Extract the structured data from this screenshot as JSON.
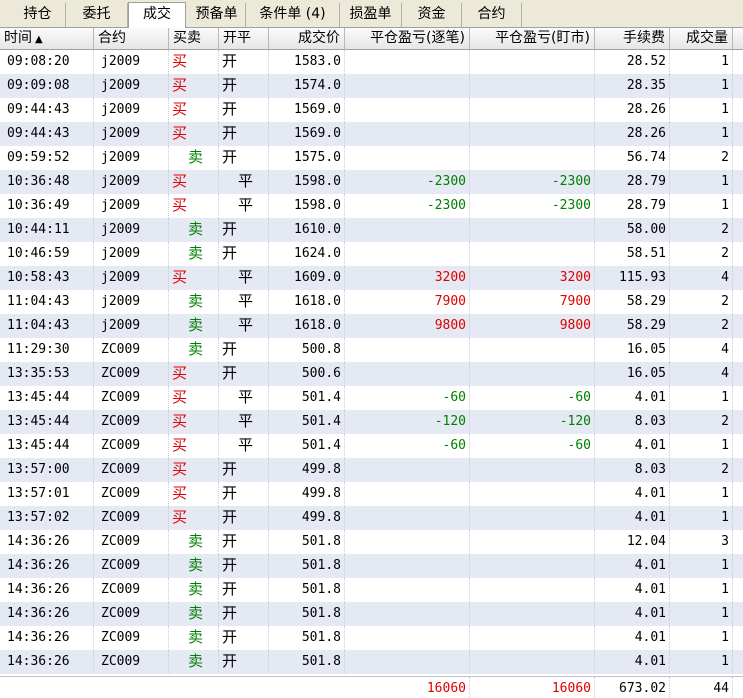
{
  "tabs": [
    {
      "label": "持仓"
    },
    {
      "label": "委托"
    },
    {
      "label": "成交"
    },
    {
      "label": "预备单"
    },
    {
      "label": "条件单 (4)"
    },
    {
      "label": "损盈单"
    },
    {
      "label": "资金"
    },
    {
      "label": "合约"
    }
  ],
  "active_tab": "成交",
  "columns": {
    "time": "时间",
    "contract": "合约",
    "side": "买卖",
    "openclose": "开平",
    "price": "成交价",
    "pnl_close": "平仓盈亏(逐笔)",
    "pnl_mark": "平仓盈亏(盯市)",
    "fee": "手续费",
    "qty": "成交量"
  },
  "sort_icon": "▲",
  "trades": [
    {
      "time": "09:08:20",
      "contract": "j2009",
      "side": "买",
      "oc": "开",
      "price": "1583.0",
      "pnl1": "",
      "pnl2": "",
      "fee": "28.52",
      "qty": "1"
    },
    {
      "time": "09:09:08",
      "contract": "j2009",
      "side": "买",
      "oc": "开",
      "price": "1574.0",
      "pnl1": "",
      "pnl2": "",
      "fee": "28.35",
      "qty": "1"
    },
    {
      "time": "09:44:43",
      "contract": "j2009",
      "side": "买",
      "oc": "开",
      "price": "1569.0",
      "pnl1": "",
      "pnl2": "",
      "fee": "28.26",
      "qty": "1"
    },
    {
      "time": "09:44:43",
      "contract": "j2009",
      "side": "买",
      "oc": "开",
      "price": "1569.0",
      "pnl1": "",
      "pnl2": "",
      "fee": "28.26",
      "qty": "1"
    },
    {
      "time": "09:59:52",
      "contract": "j2009",
      "side": "卖",
      "oc": "开",
      "price": "1575.0",
      "pnl1": "",
      "pnl2": "",
      "fee": "56.74",
      "qty": "2"
    },
    {
      "time": "10:36:48",
      "contract": "j2009",
      "side": "买",
      "oc": "平",
      "price": "1598.0",
      "pnl1": "-2300",
      "pnl2": "-2300",
      "fee": "28.79",
      "qty": "1"
    },
    {
      "time": "10:36:49",
      "contract": "j2009",
      "side": "买",
      "oc": "平",
      "price": "1598.0",
      "pnl1": "-2300",
      "pnl2": "-2300",
      "fee": "28.79",
      "qty": "1"
    },
    {
      "time": "10:44:11",
      "contract": "j2009",
      "side": "卖",
      "oc": "开",
      "price": "1610.0",
      "pnl1": "",
      "pnl2": "",
      "fee": "58.00",
      "qty": "2"
    },
    {
      "time": "10:46:59",
      "contract": "j2009",
      "side": "卖",
      "oc": "开",
      "price": "1624.0",
      "pnl1": "",
      "pnl2": "",
      "fee": "58.51",
      "qty": "2"
    },
    {
      "time": "10:58:43",
      "contract": "j2009",
      "side": "买",
      "oc": "平",
      "price": "1609.0",
      "pnl1": "3200",
      "pnl2": "3200",
      "fee": "115.93",
      "qty": "4"
    },
    {
      "time": "11:04:43",
      "contract": "j2009",
      "side": "卖",
      "oc": "平",
      "price": "1618.0",
      "pnl1": "7900",
      "pnl2": "7900",
      "fee": "58.29",
      "qty": "2"
    },
    {
      "time": "11:04:43",
      "contract": "j2009",
      "side": "卖",
      "oc": "平",
      "price": "1618.0",
      "pnl1": "9800",
      "pnl2": "9800",
      "fee": "58.29",
      "qty": "2"
    },
    {
      "time": "11:29:30",
      "contract": "ZC009",
      "side": "卖",
      "oc": "开",
      "price": "500.8",
      "pnl1": "",
      "pnl2": "",
      "fee": "16.05",
      "qty": "4"
    },
    {
      "time": "13:35:53",
      "contract": "ZC009",
      "side": "买",
      "oc": "开",
      "price": "500.6",
      "pnl1": "",
      "pnl2": "",
      "fee": "16.05",
      "qty": "4"
    },
    {
      "time": "13:45:44",
      "contract": "ZC009",
      "side": "买",
      "oc": "平",
      "price": "501.4",
      "pnl1": "-60",
      "pnl2": "-60",
      "fee": "4.01",
      "qty": "1"
    },
    {
      "time": "13:45:44",
      "contract": "ZC009",
      "side": "买",
      "oc": "平",
      "price": "501.4",
      "pnl1": "-120",
      "pnl2": "-120",
      "fee": "8.03",
      "qty": "2"
    },
    {
      "time": "13:45:44",
      "contract": "ZC009",
      "side": "买",
      "oc": "平",
      "price": "501.4",
      "pnl1": "-60",
      "pnl2": "-60",
      "fee": "4.01",
      "qty": "1"
    },
    {
      "time": "13:57:00",
      "contract": "ZC009",
      "side": "买",
      "oc": "开",
      "price": "499.8",
      "pnl1": "",
      "pnl2": "",
      "fee": "8.03",
      "qty": "2"
    },
    {
      "time": "13:57:01",
      "contract": "ZC009",
      "side": "买",
      "oc": "开",
      "price": "499.8",
      "pnl1": "",
      "pnl2": "",
      "fee": "4.01",
      "qty": "1"
    },
    {
      "time": "13:57:02",
      "contract": "ZC009",
      "side": "买",
      "oc": "开",
      "price": "499.8",
      "pnl1": "",
      "pnl2": "",
      "fee": "4.01",
      "qty": "1"
    },
    {
      "time": "14:36:26",
      "contract": "ZC009",
      "side": "卖",
      "oc": "开",
      "price": "501.8",
      "pnl1": "",
      "pnl2": "",
      "fee": "12.04",
      "qty": "3"
    },
    {
      "time": "14:36:26",
      "contract": "ZC009",
      "side": "卖",
      "oc": "开",
      "price": "501.8",
      "pnl1": "",
      "pnl2": "",
      "fee": "4.01",
      "qty": "1"
    },
    {
      "time": "14:36:26",
      "contract": "ZC009",
      "side": "卖",
      "oc": "开",
      "price": "501.8",
      "pnl1": "",
      "pnl2": "",
      "fee": "4.01",
      "qty": "1"
    },
    {
      "time": "14:36:26",
      "contract": "ZC009",
      "side": "卖",
      "oc": "开",
      "price": "501.8",
      "pnl1": "",
      "pnl2": "",
      "fee": "4.01",
      "qty": "1"
    },
    {
      "time": "14:36:26",
      "contract": "ZC009",
      "side": "卖",
      "oc": "开",
      "price": "501.8",
      "pnl1": "",
      "pnl2": "",
      "fee": "4.01",
      "qty": "1"
    },
    {
      "time": "14:36:26",
      "contract": "ZC009",
      "side": "卖",
      "oc": "开",
      "price": "501.8",
      "pnl1": "",
      "pnl2": "",
      "fee": "4.01",
      "qty": "1"
    }
  ],
  "totals": {
    "pnl1": "16060",
    "pnl2": "16060",
    "fee": "673.02",
    "qty": "44"
  },
  "colors": {
    "buy": "#e00000",
    "sell": "#008000",
    "row_alt": "#e4e9f3"
  }
}
